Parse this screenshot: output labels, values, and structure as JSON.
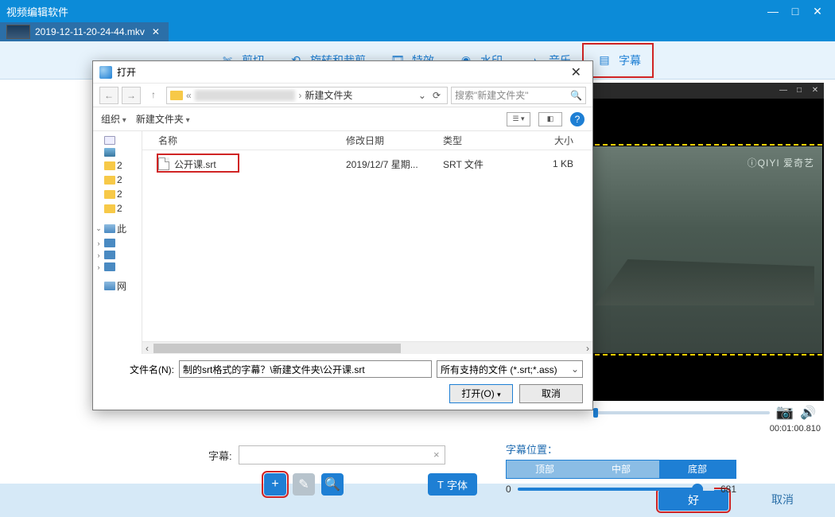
{
  "app_title": "视频编辑软件",
  "window_controls": {
    "min": "—",
    "max": "□",
    "close": "✕"
  },
  "file_tab": {
    "name": "2019-12-11-20-24-44.mkv"
  },
  "toolbar": {
    "cut": "剪切",
    "rotate": "旋转和裁剪",
    "effect": "特效",
    "watermark": "水印",
    "music": "音乐",
    "subtitle": "字幕"
  },
  "preview": {
    "watermark_text": "ⓘQIYI 爱奇艺",
    "time": "00:01:00.810"
  },
  "subtitle_panel": {
    "label": "字幕:",
    "font_btn": "字体"
  },
  "position_panel": {
    "title": "字幕位置：",
    "top": "顶部",
    "mid": "中部",
    "bot": "底部",
    "min": "0",
    "max": "681"
  },
  "footer": {
    "ok": "好",
    "cancel": "取消"
  },
  "dialog": {
    "title": "打开",
    "path_blur": "2████████",
    "path_tail": "新建文件夹",
    "search_placeholder": "搜索\"新建文件夹\"",
    "organize": "组织",
    "new_folder": "新建文件夹",
    "columns": {
      "name": "名称",
      "date": "修改日期",
      "type": "类型",
      "size": "大小"
    },
    "files": [
      {
        "name": "公开课.srt",
        "date": "2019/12/7 星期...",
        "type": "SRT 文件",
        "size": "1 KB"
      }
    ],
    "tree_labels": {
      "this_pc": "此",
      "net": "网"
    },
    "filename_label": "文件名(N):",
    "filename_value": "制的srt格式的字幕？\\新建文件夹\\公开课.srt",
    "filter": "所有支持的文件 (*.srt;*.ass)",
    "open_btn": "打开(O)",
    "cancel_btn": "取消"
  }
}
